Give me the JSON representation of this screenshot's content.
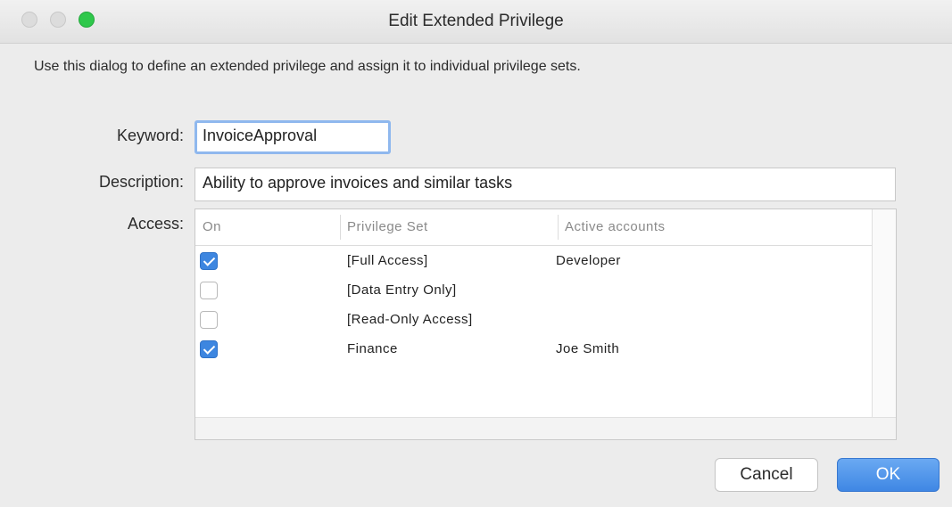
{
  "window": {
    "title": "Edit Extended Privilege"
  },
  "intro_text": "Use this dialog to define an extended privilege and assign it to individual privilege sets.",
  "form": {
    "keyword_label": "Keyword:",
    "keyword_value": "InvoiceApproval",
    "description_label": "Description:",
    "description_value": "Ability to approve invoices and similar tasks",
    "access_label": "Access:"
  },
  "access_table": {
    "columns": [
      "On",
      "Privilege Set",
      "Active accounts"
    ],
    "rows": [
      {
        "on": true,
        "privilege_set": "[Full Access]",
        "active_accounts": "Developer"
      },
      {
        "on": false,
        "privilege_set": "[Data Entry Only]",
        "active_accounts": ""
      },
      {
        "on": false,
        "privilege_set": "[Read-Only Access]",
        "active_accounts": ""
      },
      {
        "on": true,
        "privilege_set": "Finance",
        "active_accounts": "Joe Smith"
      }
    ]
  },
  "buttons": {
    "cancel_label": "Cancel",
    "ok_label": "OK"
  },
  "colors": {
    "checkbox_checked": "#3d86e0",
    "ok_button": "#3f87e4",
    "zoom_button": "#2fc84b",
    "focus_ring": "#8fb8ee"
  }
}
